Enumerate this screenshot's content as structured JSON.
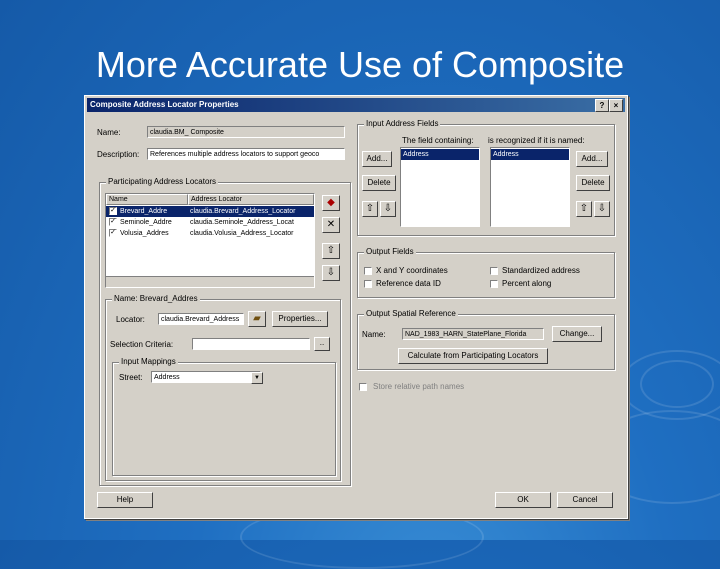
{
  "slide": {
    "title": "More Accurate Use of Composite"
  },
  "dialog": {
    "title": "Composite Address Locator Properties",
    "help_btn": "?",
    "close_btn": "×",
    "name_label": "Name:",
    "name_value": "claudia.BM_ Composite",
    "description_label": "Description:",
    "description_value": "References multiple address locators to support geoco",
    "participating": {
      "title": "Participating Address Locators",
      "columns": [
        "Name",
        "Address Locator"
      ],
      "rows": [
        {
          "checked": true,
          "name": "Brevard_Addre",
          "locator": "claudia.Brevard_Address_Locator",
          "selected": true
        },
        {
          "checked": true,
          "name": "Seminole_Addre",
          "locator": "claudia.Seminole_Address_Locat",
          "selected": false
        },
        {
          "checked": true,
          "name": "Volusia_Addres",
          "locator": "claudia.Volusia_Address_Locator",
          "selected": false
        }
      ]
    },
    "name_group": {
      "title": "Name: Brevard_Addres",
      "locator_label": "Locator:",
      "locator_value": "claudia.Brevard_Address",
      "properties_btn": "Properties...",
      "selection_label": "Selection Criteria:",
      "selection_value": "",
      "selection_btn": "..",
      "input_mappings": {
        "title": "Input Mappings",
        "street_label": "Street:",
        "street_value": "Address"
      }
    },
    "input_address_fields": {
      "title": "Input Address Fields",
      "field_col_label": "The field containing:",
      "alias_col_label": "is recognized if it is named:",
      "field_items": [
        "Address"
      ],
      "alias_items": [
        "Address"
      ],
      "add_btn": "Add...",
      "delete_btn": "Delete",
      "add2_btn": "Add...",
      "delete2_btn": "Delete"
    },
    "output_fields": {
      "title": "Output Fields",
      "options": [
        {
          "label": "X and Y coordinates",
          "checked": false
        },
        {
          "label": "Standardized address",
          "checked": false
        },
        {
          "label": "Reference data ID",
          "checked": false
        },
        {
          "label": "Percent along",
          "checked": false
        }
      ]
    },
    "spatial_reference": {
      "title": "Output Spatial Reference",
      "name_label": "Name:",
      "name_value": "NAD_1983_HARN_StatePlane_Florida",
      "change_btn": "Change...",
      "calc_btn": "Calculate from Participating Locators"
    },
    "store_label": "Store relative path names",
    "help_btn_bottom": "Help",
    "ok_btn": "OK",
    "cancel_btn": "Cancel"
  }
}
